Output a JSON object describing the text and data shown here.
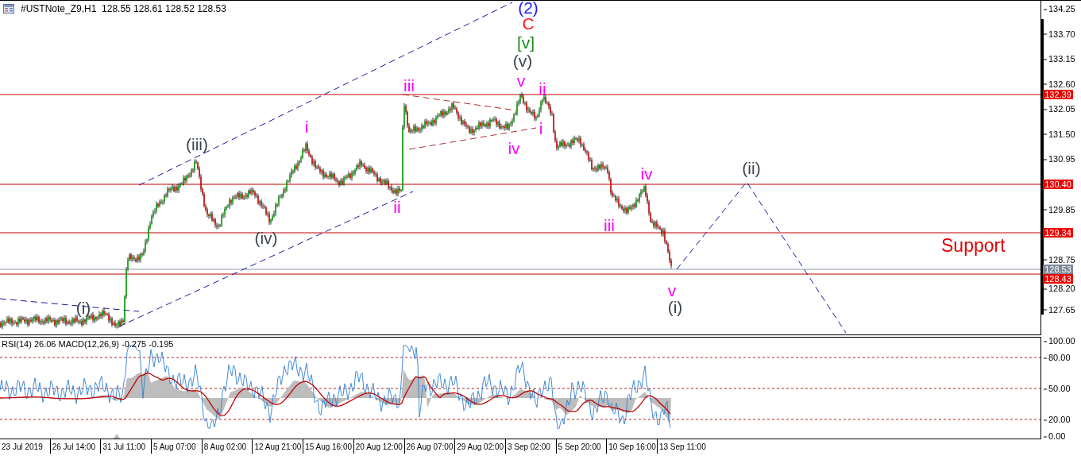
{
  "header": {
    "title": "#USTNote_Z9,H1  128.55 128.61 128.52 128.53"
  },
  "price_axis": {
    "ticks": [
      "134.25",
      "133.70",
      "133.15",
      "132.60",
      "132.05",
      "131.50",
      "130.95",
      "129.85",
      "128.75",
      "128.20",
      "127.65"
    ]
  },
  "levels": [
    {
      "kind": "line",
      "label": "132.39"
    },
    {
      "kind": "line",
      "label": "130.40"
    },
    {
      "kind": "line",
      "label": "129.34"
    },
    {
      "kind": "price",
      "label": "128.53"
    },
    {
      "kind": "line",
      "label": "128.43"
    }
  ],
  "waves": [
    {
      "text": "(2)",
      "color": "#1a1aff"
    },
    {
      "text": "C",
      "color": "#ff1a1a"
    },
    {
      "text": "[v]",
      "color": "#1a8a1a"
    },
    {
      "text": "(v)",
      "color": "#3c4650"
    },
    {
      "text": "iii",
      "color": "#ff00ff"
    },
    {
      "text": "v",
      "color": "#ff00ff"
    },
    {
      "text": "ii",
      "color": "#ff00ff"
    },
    {
      "text": "i",
      "color": "#ff00ff"
    },
    {
      "text": "i",
      "color": "#ff00ff"
    },
    {
      "text": "(iii)",
      "color": "#3c4650"
    },
    {
      "text": "iv",
      "color": "#ff00ff"
    },
    {
      "text": "iv",
      "color": "#ff00ff"
    },
    {
      "text": "(ii)",
      "color": "#3c4650"
    },
    {
      "text": "ii",
      "color": "#ff00ff"
    },
    {
      "text": "iii",
      "color": "#ff00ff"
    },
    {
      "text": "(iv)",
      "color": "#3c4650"
    },
    {
      "text": "v",
      "color": "#ff00ff"
    },
    {
      "text": "(i)",
      "color": "#3c4650"
    },
    {
      "text": "(i)",
      "color": "#3c4650"
    }
  ],
  "annotation": "Support",
  "indicator": {
    "title": "RSI(14) 26.06 MACD(12,26,9) -0.275 -0.195",
    "ticks": [
      "100.00",
      "80.00",
      "50.00",
      "20.00",
      "0.00"
    ]
  },
  "time_axis": [
    "23 Jul 2019",
    "26 Jul 14:00",
    "31 Jul 11:00",
    "5 Aug 07:00",
    "8 Aug 02:00",
    "12 Aug 21:00",
    "15 Aug 16:00",
    "20 Aug 12:00",
    "26 Aug 07:00",
    "29 Aug 02:00",
    "3 Sep 02:00",
    "5 Sep 20:00",
    "10 Sep 16:00",
    "13 Sep 11:00"
  ]
}
